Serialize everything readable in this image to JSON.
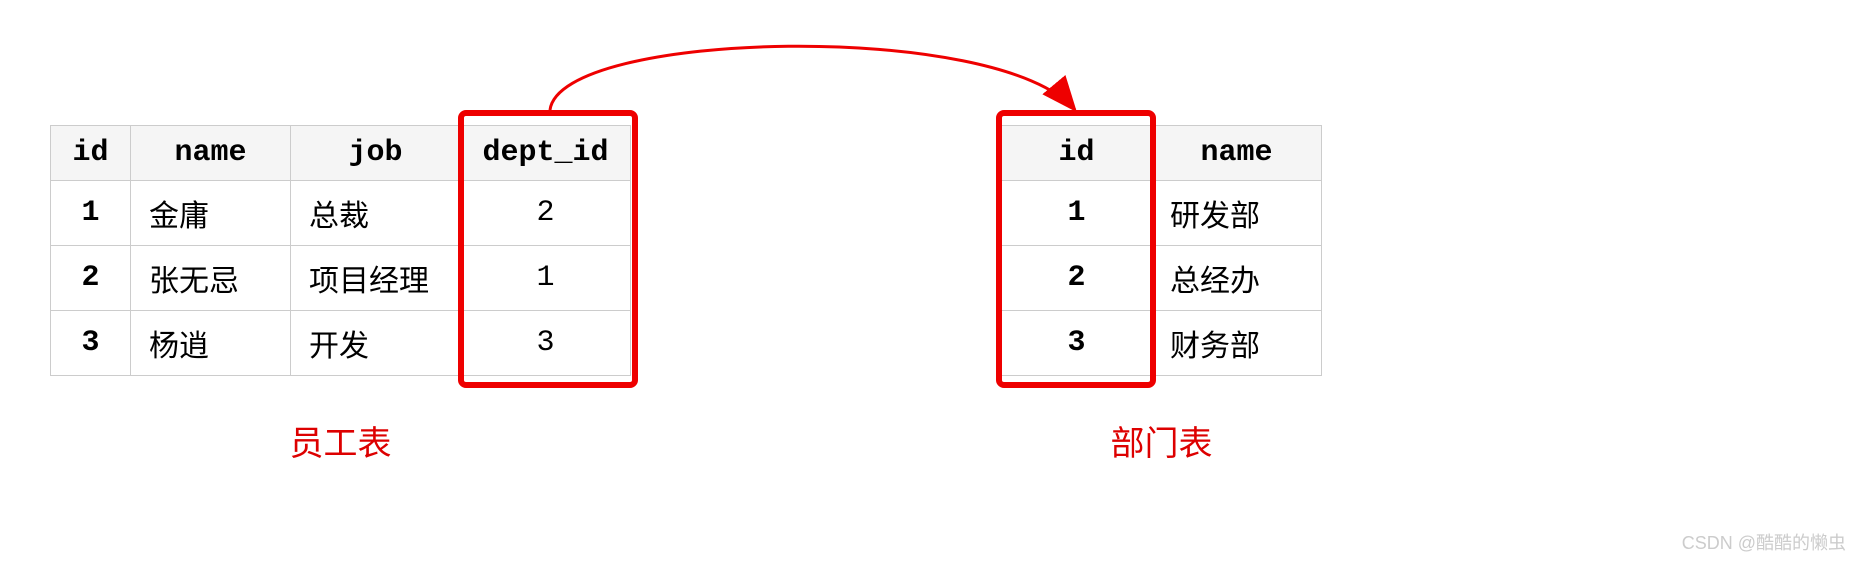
{
  "employee_table": {
    "headers": [
      "id",
      "name",
      "job",
      "dept_id"
    ],
    "rows": [
      {
        "id": "1",
        "name": "金庸",
        "job": "总裁",
        "dept_id": "2"
      },
      {
        "id": "2",
        "name": "张无忌",
        "job": "项目经理",
        "dept_id": "1"
      },
      {
        "id": "3",
        "name": "杨逍",
        "job": "开发",
        "dept_id": "3"
      }
    ],
    "caption": "员工表"
  },
  "department_table": {
    "headers": [
      "id",
      "name"
    ],
    "rows": [
      {
        "id": "1",
        "name": "研发部"
      },
      {
        "id": "2",
        "name": "总经办"
      },
      {
        "id": "3",
        "name": "财务部"
      }
    ],
    "caption": "部门表"
  },
  "relation": {
    "from": "employee_table.dept_id",
    "to": "department_table.id",
    "type": "foreign_key"
  },
  "watermark": "CSDN @酷酷的懒虫"
}
